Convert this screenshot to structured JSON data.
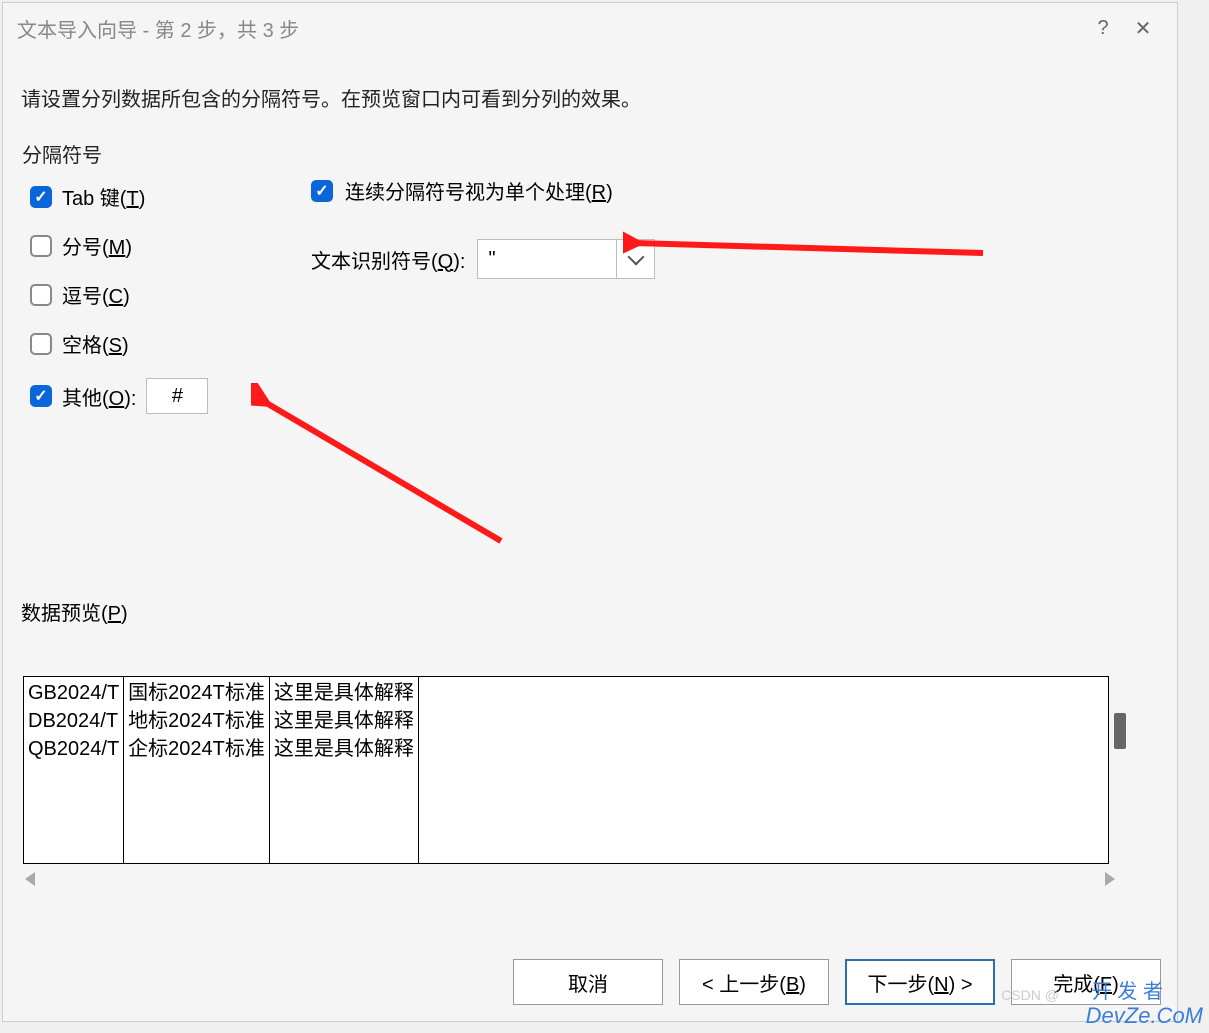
{
  "titlebar": {
    "title": "文本导入向导 - 第 2 步，共 3 步",
    "help": "?",
    "close": "✕"
  },
  "instruction": "请设置分列数据所包含的分隔符号。在预览窗口内可看到分列的效果。",
  "delimiters": {
    "group_label": "分隔符号",
    "tab": {
      "label_pre": "Tab 键(",
      "key": "T",
      "label_post": ")",
      "checked": true
    },
    "semicolon": {
      "label_pre": "分号(",
      "key": "M",
      "label_post": ")",
      "checked": false
    },
    "comma": {
      "label_pre": "逗号(",
      "key": "C",
      "label_post": ")",
      "checked": false
    },
    "space": {
      "label_pre": "空格(",
      "key": "S",
      "label_post": ")",
      "checked": false
    },
    "other": {
      "label_pre": "其他(",
      "key": "O",
      "label_post": "):",
      "checked": true,
      "value": "#"
    }
  },
  "options": {
    "treat_consecutive": {
      "label_pre": "连续分隔符号视为单个处理(",
      "key": "R",
      "label_post": ")",
      "checked": true
    },
    "text_qualifier": {
      "label_pre": "文本识别符号(",
      "key": "Q",
      "label_post": "):",
      "value": "\""
    }
  },
  "preview": {
    "label_pre": "数据预览(",
    "key": "P",
    "label_post": ")",
    "columns": [
      [
        "GB2024/T",
        "DB2024/T",
        "QB2024/T"
      ],
      [
        "国标2024T标准",
        "地标2024T标准",
        "企标2024T标准"
      ],
      [
        "这里是具体解释",
        "这里是具体解释",
        "这里是具体解释"
      ]
    ]
  },
  "footer": {
    "cancel": "取消",
    "back_pre": "< 上一步(",
    "back_key": "B",
    "back_post": ")",
    "next_pre": "下一步(",
    "next_key": "N",
    "next_post": ") >",
    "finish_pre": "完成(",
    "finish_key": "F",
    "finish_post": ")"
  },
  "watermark": {
    "csdn": "CSDN @",
    "devze": "DevZe.CoM",
    "extra": "开 发 者"
  }
}
